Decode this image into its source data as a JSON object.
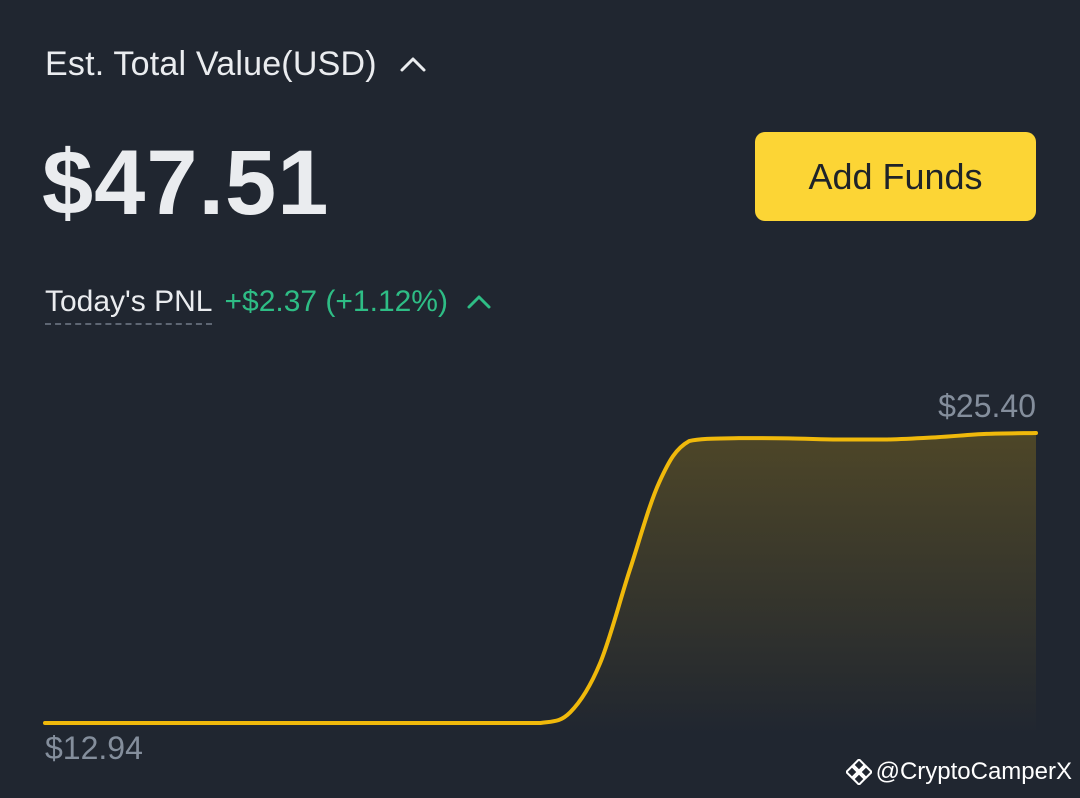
{
  "header": {
    "title": "Est. Total Value(USD)",
    "toggle_icon": "chevron-up-icon"
  },
  "balance": {
    "amount": "$47.51"
  },
  "actions": {
    "add_funds_label": "Add Funds",
    "add_funds_color": "#fcd535"
  },
  "pnl": {
    "label": "Today's PNL",
    "value": "+$2.37 (+1.12%)",
    "color": "#2ebd85",
    "toggle_icon": "chevron-up-icon"
  },
  "chart_data": {
    "type": "area",
    "max_label": "$25.40",
    "min_label": "$12.94",
    "ylim": [
      12.94,
      25.4
    ],
    "x": [
      0,
      10,
      20,
      30,
      40,
      45,
      50,
      53,
      56,
      59,
      62,
      65,
      70,
      75,
      80,
      85,
      90,
      95,
      100
    ],
    "values": [
      12.94,
      12.94,
      12.94,
      12.94,
      12.94,
      12.94,
      12.94,
      13.4,
      15.5,
      19.5,
      23.3,
      25.05,
      25.18,
      25.17,
      25.12,
      25.12,
      25.22,
      25.36,
      25.4
    ],
    "line_color": "#f0b90b"
  },
  "watermark": {
    "text": "@CryptoCamperX",
    "logo_icon": "binance-logo-icon"
  }
}
